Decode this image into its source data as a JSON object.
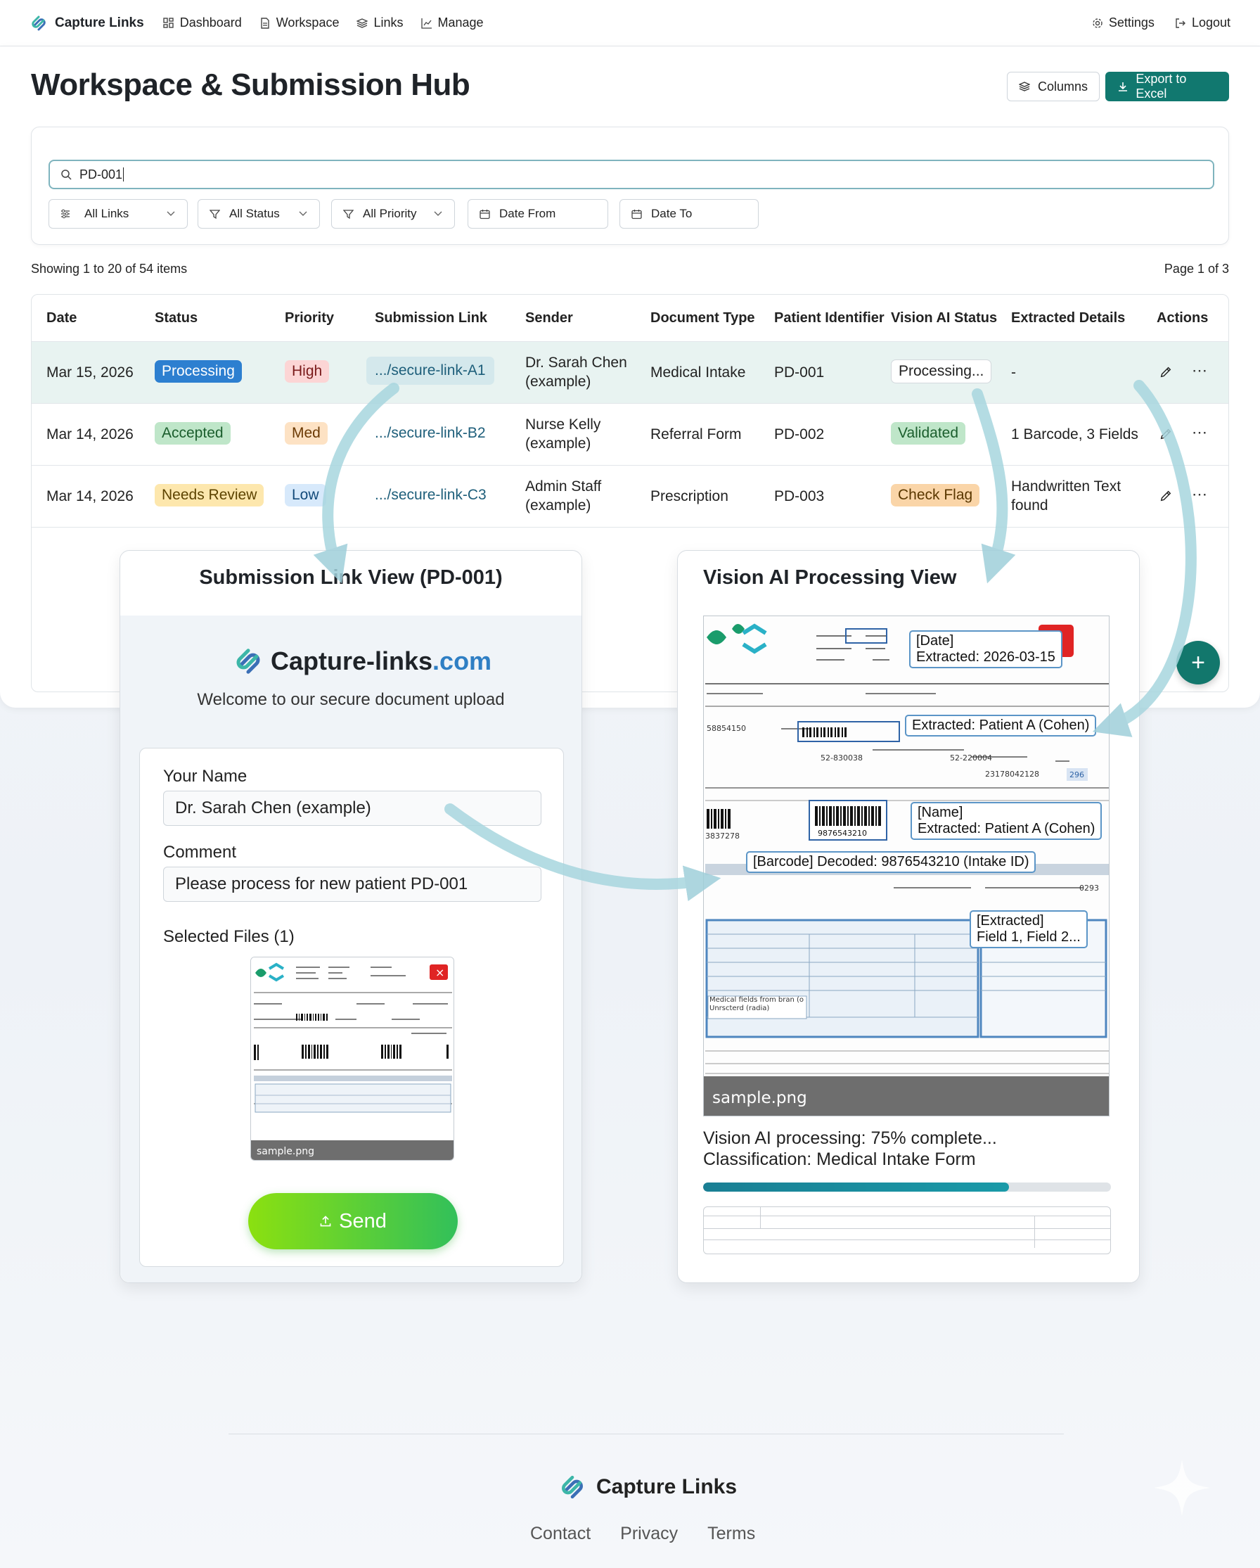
{
  "nav": {
    "brand": "Capture Links",
    "items": [
      {
        "label": "Dashboard",
        "icon": "dashboard-icon"
      },
      {
        "label": "Workspace",
        "icon": "document-icon"
      },
      {
        "label": "Links",
        "icon": "layers-icon"
      },
      {
        "label": "Manage",
        "icon": "chart-icon"
      }
    ],
    "settings": "Settings",
    "logout": "Logout"
  },
  "page": {
    "title": "Workspace & Submission Hub",
    "columns_button": "Columns",
    "export_button": "Export to Excel"
  },
  "filters": {
    "search_value": "PD-001",
    "links": "All Links",
    "status": "All Status",
    "priority": "All Priority",
    "date_from": "Date From",
    "date_to": "Date To"
  },
  "table": {
    "showing": "Showing 1 to 20 of 54 items",
    "page": "Page 1 of 3",
    "columns": [
      "Date",
      "Status",
      "Priority",
      "Submission Link",
      "Sender",
      "Document Type",
      "Patient Identifier",
      "Vision AI Status",
      "Extracted Details",
      "Actions"
    ],
    "rows": [
      {
        "date": "Mar 15, 2026",
        "status": "Processing",
        "priority": "High",
        "link": ".../secure-link-A1",
        "sender": "Dr. Sarah Chen (example)",
        "doc_type": "Medical Intake",
        "patient": "PD-001",
        "ai_status": "Processing...",
        "details": "-"
      },
      {
        "date": "Mar 14, 2026",
        "status": "Accepted",
        "priority": "Med",
        "link": ".../secure-link-B2",
        "sender": "Nurse Kelly (example)",
        "doc_type": "Referral Form",
        "patient": "PD-002",
        "ai_status": "Validated",
        "details": "1 Barcode, 3 Fields"
      },
      {
        "date": "Mar 14, 2026",
        "status": "Needs Review",
        "priority": "Low",
        "link": ".../secure-link-C3",
        "sender": "Admin Staff (example)",
        "doc_type": "Prescription",
        "patient": "PD-003",
        "ai_status": "Check Flag",
        "details": "Handwritten Text found"
      }
    ]
  },
  "submission_view": {
    "title": "Submission Link View (PD-001)",
    "logo_main": "Capture-links",
    "logo_tld": ".com",
    "welcome": "Welcome to our secure document upload",
    "name_label": "Your Name",
    "name_value": "Dr. Sarah Chen (example)",
    "comment_label": "Comment",
    "comment_value": "Please process for new patient PD-001",
    "files_label": "Selected Files (1)",
    "file_name": "sample.png",
    "send_button": "Send"
  },
  "vision_view": {
    "title": "Vision AI Processing View",
    "ann_date": "[Date]\nExtracted: 2026-03-15",
    "ann_patient": "Extracted: Patient A (Cohen)",
    "ann_name": "[Name]\nExtracted: Patient A (Cohen)",
    "ann_barcode": "[Barcode] Decoded: 9876543210 (Intake ID)",
    "ann_fields": "[Extracted]\nField 1, Field 2...",
    "barcode_number": "9876543210",
    "file_name": "sample.png",
    "progress_text": "Vision AI processing: 75% complete...",
    "classification": "Classification: Medical Intake Form",
    "progress": 0.75,
    "form_label": "Medical fields from bran (o Unrscterd (radia)"
  },
  "footer": {
    "brand": "Capture Links",
    "links": [
      "Contact",
      "Privacy",
      "Terms"
    ]
  },
  "colors": {
    "accent": "#11786f",
    "processing": "#2d7fd0",
    "send_start": "#8be010",
    "send_end": "#32c05a"
  }
}
